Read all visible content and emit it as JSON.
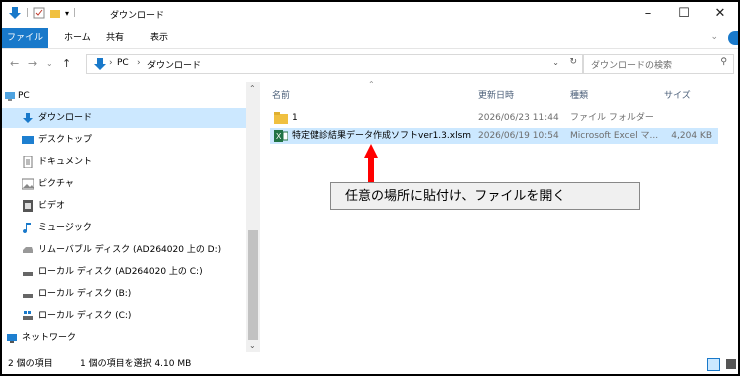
{
  "window": {
    "title": "ダウンロード",
    "controls": {
      "minimize": "–",
      "maximize": "☐",
      "close": "✕"
    }
  },
  "ribbon": {
    "tabs": [
      "ファイル",
      "ホーム",
      "共有",
      "表示"
    ]
  },
  "address": {
    "path": [
      "PC",
      "ダウンロード"
    ],
    "search_placeholder": "ダウンロードの検索"
  },
  "nav": {
    "items": [
      {
        "label": "PC",
        "icon": "computer-icon"
      },
      {
        "label": "ダウンロード",
        "icon": "download-icon",
        "selected": true
      },
      {
        "label": "デスクトップ",
        "icon": "desktop-icon"
      },
      {
        "label": "ドキュメント",
        "icon": "document-icon"
      },
      {
        "label": "ピクチャ",
        "icon": "picture-icon"
      },
      {
        "label": "ビデオ",
        "icon": "video-icon"
      },
      {
        "label": "ミュージック",
        "icon": "music-icon"
      },
      {
        "label": "リムーバブル ディスク (AD264020 上の D:)",
        "icon": "removable-disk-icon"
      },
      {
        "label": "ローカル ディスク (AD264020 上の C:)",
        "icon": "local-disk-icon"
      },
      {
        "label": "ローカル ディスク (B:)",
        "icon": "local-disk-icon"
      },
      {
        "label": "ローカル ディスク (C:)",
        "icon": "windows-disk-icon"
      },
      {
        "label": "ネットワーク",
        "icon": "network-icon"
      }
    ]
  },
  "columns": {
    "name": "名前",
    "date": "更新日時",
    "type": "種類",
    "size": "サイズ"
  },
  "files": [
    {
      "name": "1",
      "date": "2026/06/23 11:44",
      "type": "ファイル フォルダー",
      "size": "",
      "icon": "folder-icon"
    },
    {
      "name": "特定健診結果データ作成ソフトver1.3.xlsm",
      "date": "2026/06/19 10:54",
      "type": "Microsoft Excel マ...",
      "size": "4,204 KB",
      "icon": "excel-icon",
      "selected": true
    }
  ],
  "annotation": "任意の場所に貼付け、ファイルを開く",
  "status": {
    "items": "2 個の項目",
    "selected": "1 個の項目を選択 4.10 MB"
  },
  "colors": {
    "accent": "#1979ca",
    "selection": "#cce8ff",
    "arrow": "#ff0000"
  }
}
